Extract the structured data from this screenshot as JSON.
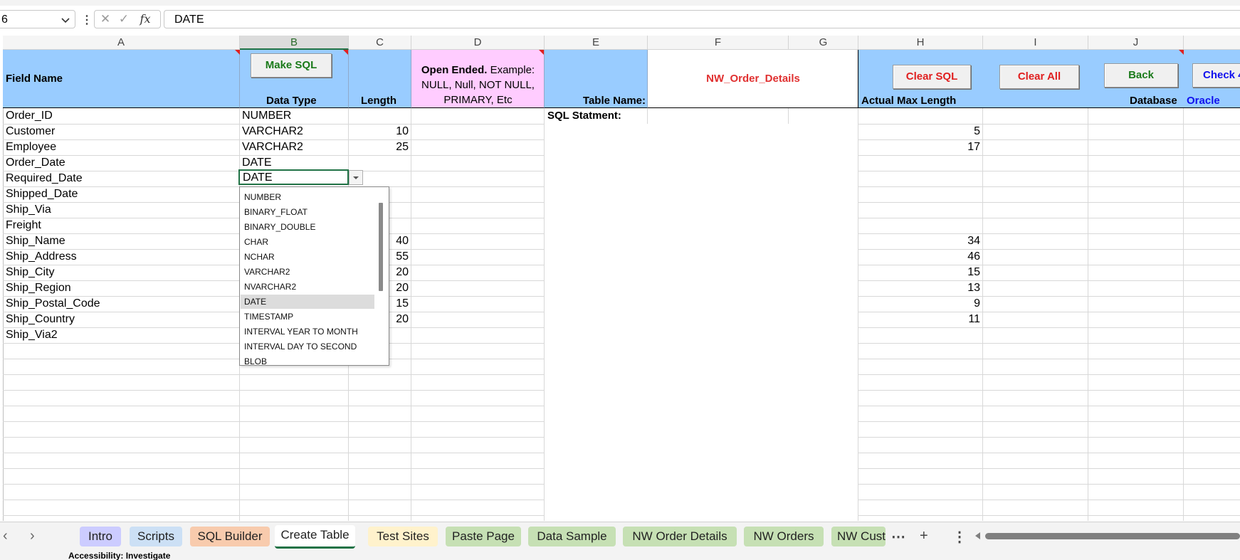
{
  "formula_bar": {
    "name_box": "6",
    "formula": "DATE"
  },
  "columns": [
    "A",
    "B",
    "C",
    "D",
    "E",
    "F",
    "G",
    "H",
    "I",
    "J"
  ],
  "header_row": {
    "field_name": "Field Name",
    "make_sql_button": "Make SQL",
    "data_type": "Data Type",
    "length": "Length",
    "open_ended_bold": "Open Ended.",
    "open_ended_rest": " Example:",
    "open_ended_line2": "NULL, Null, NOT NULL,",
    "open_ended_line3": "PRIMARY, Etc",
    "table_name_label": "Table Name:",
    "table_name_value": "NW_Order_Details",
    "clear_sql_button": "Clear SQL",
    "clear_all_button": "Clear All",
    "back_button": "Back",
    "check_button": "Check 4",
    "actual_max_length": "Actual Max Length",
    "database_label": "Database",
    "database_value": "Oracle",
    "sql_statement_label": "SQL Statment:"
  },
  "rows": [
    {
      "field": "Order_ID",
      "type": "NUMBER",
      "length": "",
      "max": ""
    },
    {
      "field": "Customer",
      "type": "VARCHAR2",
      "length": "10",
      "max": "5"
    },
    {
      "field": "Employee",
      "type": "VARCHAR2",
      "length": "25",
      "max": "17"
    },
    {
      "field": "Order_Date",
      "type": "DATE",
      "length": "",
      "max": ""
    },
    {
      "field": "Required_Date",
      "type": "DATE",
      "length": "",
      "max": ""
    },
    {
      "field": "Shipped_Date",
      "type": "",
      "length": "",
      "max": ""
    },
    {
      "field": "Ship_Via",
      "type": "",
      "length": "",
      "max": ""
    },
    {
      "field": "Freight",
      "type": "",
      "length": "",
      "max": ""
    },
    {
      "field": "Ship_Name",
      "type": "",
      "length": "40",
      "max": "34"
    },
    {
      "field": "Ship_Address",
      "type": "",
      "length": "55",
      "max": "46"
    },
    {
      "field": "Ship_City",
      "type": "",
      "length": "20",
      "max": "15"
    },
    {
      "field": "Ship_Region",
      "type": "",
      "length": "20",
      "max": "13"
    },
    {
      "field": "Ship_Postal_Code",
      "type": "",
      "length": "15",
      "max": "9"
    },
    {
      "field": "Ship_Country",
      "type": "",
      "length": "20",
      "max": "11"
    },
    {
      "field": "Ship_Via2",
      "type": "",
      "length": "",
      "max": ""
    }
  ],
  "dropdown": {
    "selected": "DATE",
    "options": [
      "NUMBER",
      "BINARY_FLOAT",
      "BINARY_DOUBLE",
      "CHAR",
      "NCHAR",
      "VARCHAR2",
      "NVARCHAR2",
      "DATE",
      "TIMESTAMP",
      "INTERVAL YEAR TO MONTH",
      "INTERVAL DAY TO SECOND",
      "BLOB"
    ]
  },
  "sheet_tabs": [
    {
      "label": "Intro",
      "color": "#ccccff"
    },
    {
      "label": "Scripts",
      "color": "#cce0f5"
    },
    {
      "label": "SQL Builder",
      "color": "#f8cbad"
    },
    {
      "label": "Create Table",
      "color": "#ffffff"
    },
    {
      "label": "Test Sites",
      "color": "#fff2cc"
    },
    {
      "label": "Paste Page",
      "color": "#c6e0b4"
    },
    {
      "label": "Data Sample",
      "color": "#c6e0b4"
    },
    {
      "label": "NW Order Details",
      "color": "#c6e0b4"
    },
    {
      "label": "NW Orders",
      "color": "#c6e0b4"
    },
    {
      "label": "NW Cust",
      "color": "#c6e0b4"
    }
  ],
  "status_bar": {
    "accessibility": "Accessibility: Investigate"
  },
  "colors": {
    "header_blue": "#99ccff",
    "pink": "#ffccff",
    "table_name_red": "#e03030",
    "green_text": "#1a7a1a",
    "oracle_blue": "#1010ee",
    "excel_green": "#217346"
  },
  "icons": [
    "chevron-down-icon",
    "cancel-icon",
    "check-icon",
    "fx-icon",
    "more-icon",
    "add-sheet-icon",
    "scroll-left-icon",
    "scroll-right-icon",
    "dropdown-arrow-icon"
  ]
}
